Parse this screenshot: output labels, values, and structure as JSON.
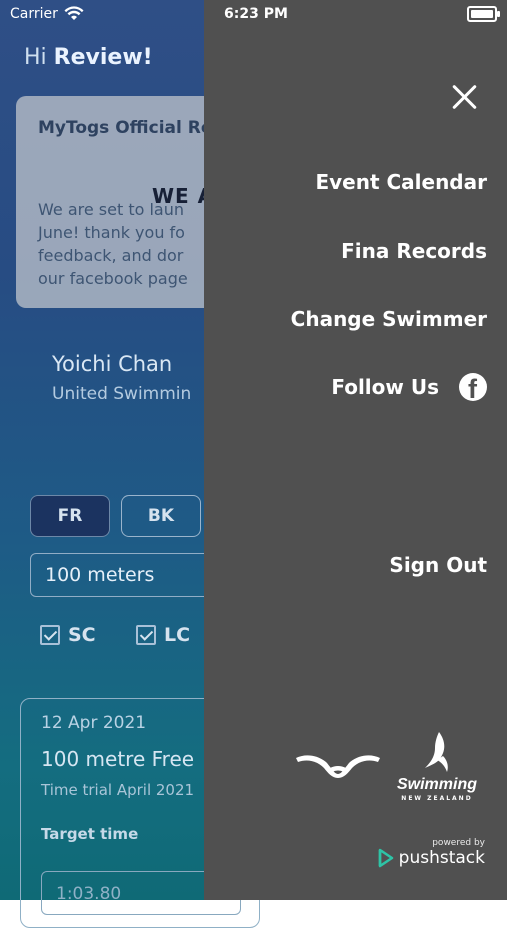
{
  "status": {
    "carrier": "Carrier",
    "time": "6:23 PM"
  },
  "app": {
    "greeting_prefix": "Hi ",
    "greeting_name": "Review!",
    "card": {
      "title": "MyTogs Official Re",
      "overlay": "WE A",
      "body": "We are set to laun\nJune! thank you fo\nfeedback, and dor\nour facebook page"
    },
    "swimmer": {
      "name": "Yoichi Chan",
      "club": "United Swimmin"
    },
    "strokes": [
      "FR",
      "BK"
    ],
    "distance": "100 meters",
    "courses": [
      "SC",
      "LC"
    ],
    "record": {
      "date": "12 Apr 2021",
      "event": "100 metre Free",
      "meet": "Time trial April 2021",
      "target_label": "Target time",
      "target_value": "1:03.80"
    }
  },
  "drawer": {
    "menu": [
      "Event Calendar",
      "Fina Records",
      "Change Swimmer",
      "Follow Us",
      "Sign Out"
    ],
    "logos": {
      "swimming_word": "Swimming",
      "swimming_sub": "NEW ZEALAND"
    },
    "powered_by": "powered by",
    "brand": "pushstack"
  },
  "icons": [
    "wifi-icon",
    "battery-icon",
    "close-icon",
    "facebook-icon",
    "checkbox-icon",
    "pushstack-icon"
  ]
}
